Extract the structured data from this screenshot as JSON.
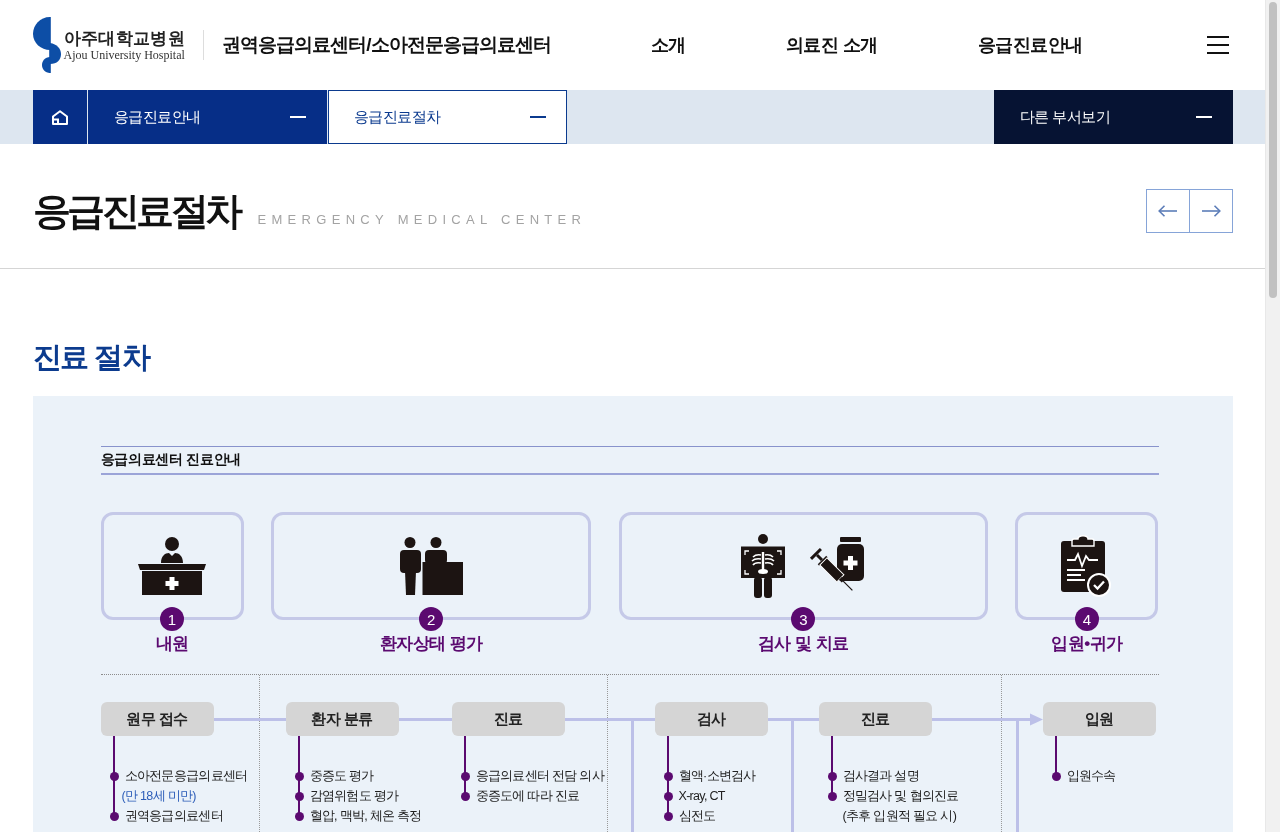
{
  "header": {
    "logo": {
      "name": "아주대학교병원",
      "name_en": "Ajou University Hospital"
    },
    "site_title": "권역응급의료센터/소아전문응급의료센터",
    "nav": [
      {
        "label": "소개"
      },
      {
        "label": "의료진 소개"
      },
      {
        "label": "응급진료안내"
      }
    ]
  },
  "breadcrumb": {
    "items": [
      {
        "kind": "category",
        "label": "응급진료안내"
      },
      {
        "kind": "page",
        "label": "응급진료절차"
      }
    ],
    "other": {
      "label": "다른 부서보기"
    }
  },
  "page_header": {
    "title": "응급진료절차",
    "subtitle": "EMERGENCY MEDICAL CENTER"
  },
  "section": {
    "heading": "진료 절차",
    "diagram": {
      "title": "응급의료센터 진료안내",
      "steps": [
        {
          "number": "1",
          "label": "내원"
        },
        {
          "number": "2",
          "label": "환자상태 평가"
        },
        {
          "number": "3",
          "label": "검사 및 치료"
        },
        {
          "number": "4",
          "label": "입원•귀가"
        }
      ],
      "flow": [
        {
          "label": "원무 접수",
          "items": [
            {
              "text": "소아전문응급의료센터",
              "note": "(만 18세 미만)"
            },
            {
              "text": "권역응급의료센터"
            }
          ]
        },
        {
          "label": "환자 분류",
          "items": [
            {
              "text": "중증도 평가"
            },
            {
              "text": "감염위험도 평가"
            },
            {
              "text": "혈압, 맥박, 체온 측정"
            }
          ]
        },
        {
          "label": "진료",
          "items": [
            {
              "text": "응급의료센터 전담 의사"
            },
            {
              "text": "중증도에 따라 진료"
            }
          ]
        },
        {
          "label": "검사",
          "items": [
            {
              "text": "혈액·소변검사"
            },
            {
              "text": "X-ray, CT"
            },
            {
              "text": "심전도"
            }
          ]
        },
        {
          "label": "진료",
          "items": [
            {
              "text": "검사결과 설명"
            },
            {
              "text": "정밀검사 및 협의진료",
              "detail": "(추후 입원적 필요 시)"
            }
          ]
        },
        {
          "label": "입원",
          "items": [
            {
              "text": "입원수속"
            }
          ]
        }
      ]
    }
  }
}
